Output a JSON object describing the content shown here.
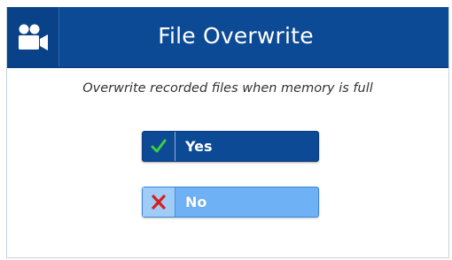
{
  "header": {
    "title": "File Overwrite",
    "icon": "video-camera-icon",
    "color": "#0d4a95"
  },
  "prompt": "Overwrite recorded files when memory is full",
  "options": [
    {
      "label": "Yes",
      "icon": "checkmark-icon",
      "icon_color": "#3ecf3e",
      "selected": true
    },
    {
      "label": "No",
      "icon": "x-icon",
      "icon_color": "#d62020",
      "selected": false
    }
  ]
}
